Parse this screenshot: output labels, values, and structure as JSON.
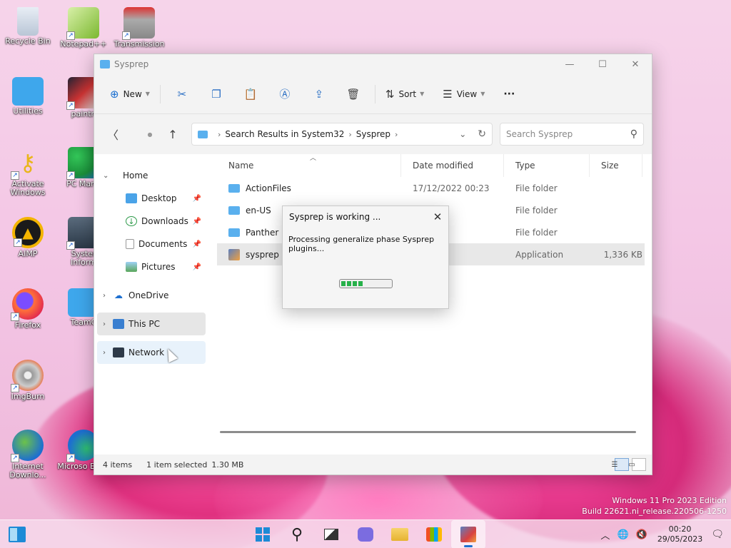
{
  "desktop": {
    "icons": [
      {
        "label": "Recycle Bin"
      },
      {
        "label": "Notepad++"
      },
      {
        "label": "Transmission"
      },
      {
        "label": "Utilities"
      },
      {
        "label": "paintn"
      },
      {
        "label": "Activate Windows"
      },
      {
        "label": "PC Mana"
      },
      {
        "label": "AIMP"
      },
      {
        "label": "Syster Inform"
      },
      {
        "label": "Firefox"
      },
      {
        "label": "TeamC"
      },
      {
        "label": "ImgBurn"
      },
      {
        "label": "Internet Downlo..."
      },
      {
        "label": "Microso Edge"
      }
    ]
  },
  "explorer": {
    "title": "Sysprep",
    "commands": {
      "new_label": "New",
      "sort_label": "Sort",
      "view_label": "View",
      "more_label": "···"
    },
    "address": {
      "crumbs": [
        "Search Results in System32",
        "Sysprep"
      ]
    },
    "search": {
      "placeholder": "Search Sysprep"
    },
    "sidebar": {
      "home": "Home",
      "quick": [
        "Desktop",
        "Downloads",
        "Documents",
        "Pictures"
      ],
      "onedrive": "OneDrive",
      "thispc": "This PC",
      "network": "Network"
    },
    "columns": {
      "name": "Name",
      "date": "Date modified",
      "type": "Type",
      "size": "Size"
    },
    "rows": [
      {
        "name": "ActionFiles",
        "date": "17/12/2022 00:23",
        "type": "File folder",
        "size": ""
      },
      {
        "name": "en-US",
        "date": "",
        "type": "File folder",
        "size": ""
      },
      {
        "name": "Panther",
        "date": "",
        "type": "File folder",
        "size": ""
      },
      {
        "name": "sysprep",
        "date": "",
        "type": "Application",
        "size": "1,336 KB"
      }
    ],
    "status": {
      "items": "4 items",
      "selected": "1 item selected",
      "size": "1.30 MB"
    }
  },
  "dialog": {
    "title": "Sysprep is working ...",
    "message": "Processing generalize phase Sysprep plugins...",
    "progress": 0.45
  },
  "watermark": {
    "line1": "Windows 11 Pro 2023 Edition",
    "line2": "Build 22621.ni_release.220506-1250"
  },
  "taskbar": {
    "time": "00:20",
    "date": "29/05/2023"
  },
  "colors": {
    "accent": "#1d6fd0",
    "folder": "#5ab0ee",
    "progress": "#27b14a"
  }
}
